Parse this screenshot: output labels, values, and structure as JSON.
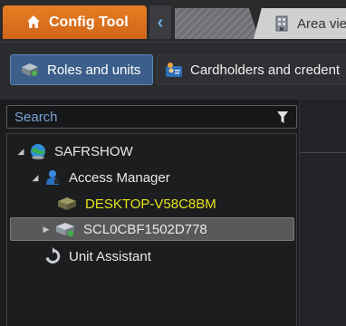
{
  "tabs": {
    "config_tool_label": "Config Tool",
    "area_view_label": "Area vie"
  },
  "subnav": {
    "roles_units_label": "Roles and units",
    "cardholders_label": "Cardholders and credent"
  },
  "search": {
    "placeholder": "Search"
  },
  "tree": {
    "nodes": [
      {
        "label": "SAFRSHOW",
        "icon": "server-globe-icon",
        "expanded": true
      },
      {
        "label": "Access Manager",
        "icon": "access-manager-icon",
        "expanded": true
      },
      {
        "label": "DESKTOP-V58C8BM",
        "icon": "unit-offline-icon",
        "color": "#e6e21a"
      },
      {
        "label": "SCL0CBF1502D778",
        "icon": "unit-online-icon",
        "selected": true
      },
      {
        "label": "Unit Assistant",
        "icon": "unit-assistant-icon"
      }
    ]
  },
  "colors": {
    "accent_orange": "#d86d1c",
    "selected_pill": "#3b5f8a",
    "warning_text": "#e6e21a"
  }
}
